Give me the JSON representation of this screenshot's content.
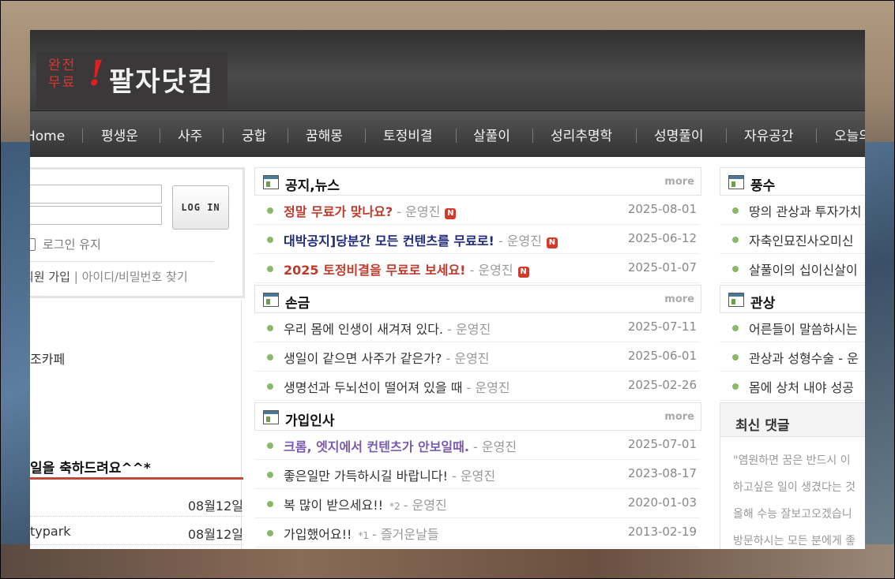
{
  "header": {
    "logo_small": "완전무료",
    "logo_bang": "!",
    "logo_main": "팔자닷컴"
  },
  "nav": {
    "items": [
      "Home",
      "평생운",
      "사주",
      "궁합",
      "꿈해몽",
      "토정비결",
      "살풀이",
      "성리추명학",
      "성명풀이",
      "자유공간",
      "오늘의"
    ]
  },
  "login": {
    "button": "LOG IN",
    "keep_label": "로그인 유지",
    "join": "회원 가입",
    "sep": "|",
    "find": "아이디/비밀번호 찾기"
  },
  "left": {
    "cafe_label": "조카페",
    "birthday_title": "일을 축하드려요^^*",
    "birthdays": [
      {
        "name": "",
        "date": "08월12일"
      },
      {
        "name": "typark",
        "date": "08월12일"
      }
    ]
  },
  "sections": [
    {
      "title": "공지,뉴스",
      "more": "more",
      "posts": [
        {
          "title": "정말 무료가 맞나요?",
          "author": "- 운영진",
          "sub": "",
          "badge": "N",
          "date": "2025-08-01",
          "style": "red"
        },
        {
          "title": "대박공지]당분간 모든 컨텐츠를 무료로!",
          "author": "- 운영진",
          "sub": "",
          "badge": "N",
          "date": "2025-06-12",
          "style": "navy"
        },
        {
          "title": "2025 토정비결을 무료로 보세요!",
          "author": "- 운영진",
          "sub": "",
          "badge": "N",
          "date": "2025-01-07",
          "style": "red"
        }
      ]
    },
    {
      "title": "손금",
      "more": "more",
      "posts": [
        {
          "title": "우리 몸에 인생이 새겨져 있다.",
          "author": "- 운영진",
          "sub": "",
          "badge": "",
          "date": "2025-07-11",
          "style": ""
        },
        {
          "title": "생일이 같으면 사주가 같은가?",
          "author": "- 운영진",
          "sub": "",
          "badge": "",
          "date": "2025-06-01",
          "style": ""
        },
        {
          "title": "생명선과 두뇌선이 떨어져 있을 때",
          "author": "- 운영진",
          "sub": "",
          "badge": "",
          "date": "2025-02-26",
          "style": ""
        }
      ]
    },
    {
      "title": "가입인사",
      "more": "more",
      "posts": [
        {
          "title": "크롬, 엣지에서 컨텐츠가 안보일때.",
          "author": "- 운영진",
          "sub": "",
          "badge": "",
          "date": "2025-07-01",
          "style": "purple"
        },
        {
          "title": "좋은일만 가득하시길 바랍니다!",
          "author": "- 운영진",
          "sub": "",
          "badge": "",
          "date": "2023-08-17",
          "style": ""
        },
        {
          "title": "복 많이 받으세요!!",
          "author": "- 운영진",
          "sub": "*2",
          "badge": "",
          "date": "2020-01-03",
          "style": ""
        },
        {
          "title": "가입했어요!!",
          "author": "- 즐거운날들",
          "sub": "*1",
          "badge": "",
          "date": "2013-02-19",
          "style": ""
        }
      ]
    }
  ],
  "right_sections": [
    {
      "title": "풍수",
      "posts": [
        "땅의 관상과 투자가치",
        "자축인묘진사오미신",
        "살풀이의 십이신살이"
      ]
    },
    {
      "title": "관상",
      "posts": [
        "어른들이 말씀하시는",
        "관상과 성형수술 - 운",
        "몸에 상처 내야 성공"
      ]
    }
  ],
  "comments": {
    "title": "최신 댓글",
    "lines": [
      "\"염원하면 꿈은 반드시 이",
      "하고싶은 일이 생겼다는 것",
      "올해 수능 잘보고오겠습니",
      "방문하시는 모든 분에게 좋"
    ]
  },
  "colors": {
    "header_dark": "#3c3c3c",
    "nav_bg": "#444444",
    "accent_red": "#c0392b",
    "accent_navy": "#1f2a7a",
    "accent_purple": "#7a5ab0",
    "bullet_green": "#8ab86a"
  }
}
